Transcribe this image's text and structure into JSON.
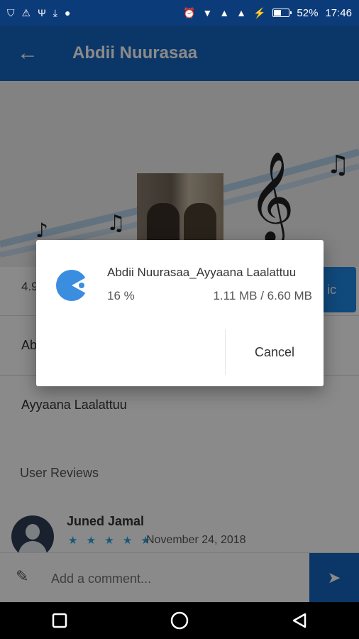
{
  "status_bar": {
    "battery_percent": "52%",
    "battery_level": 0.52,
    "time": "17:46"
  },
  "app_bar": {
    "title": "Abdii Nuurasaa"
  },
  "detail": {
    "rating_partial": "4.9",
    "get_button_partial": "ic",
    "list_items": [
      "Ab",
      "Ayyaana Laalattuu"
    ],
    "reviews_heading": "User Reviews",
    "review": {
      "name": "Juned Jamal",
      "stars": 5,
      "stars_text": "★ ★ ★ ★ ★",
      "date": "November 24, 2018"
    }
  },
  "comment_bar": {
    "placeholder": "Add a comment..."
  },
  "dialog": {
    "file_name": "Abdii Nuurasaa_Ayyaana Laalattuu",
    "percent": "16 %",
    "progress": 0.16,
    "size": "1.11 MB / 6.60 MB",
    "cancel_label": "Cancel"
  },
  "colors": {
    "status_bar": "#0c3b7a",
    "app_bar": "#1565c0",
    "accent": "#1e88e5",
    "star": "#29a3e0"
  },
  "icons": {
    "back": "arrow-left-icon",
    "send": "send-icon",
    "edit": "pencil-icon",
    "download": "progress-pie-icon"
  }
}
